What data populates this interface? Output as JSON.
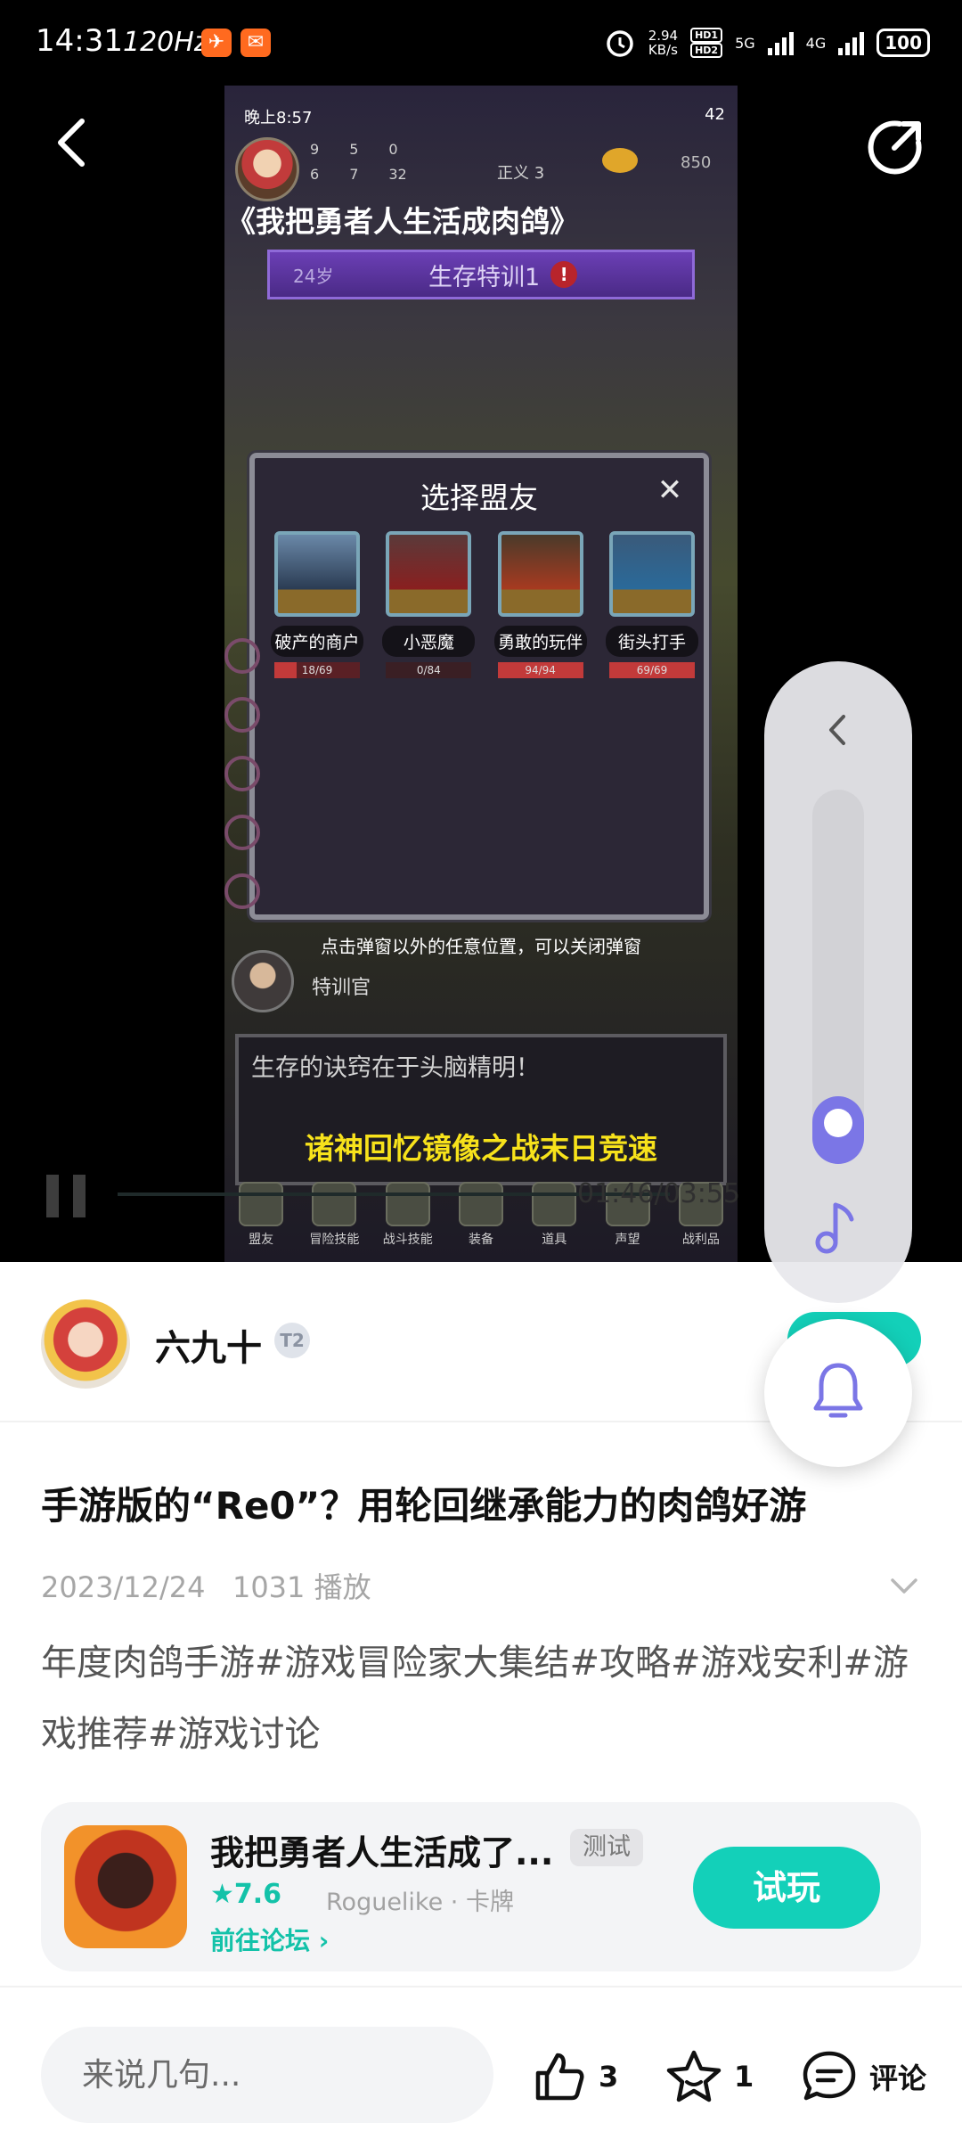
{
  "status_bar": {
    "time": "14:31",
    "refresh": "120Hz",
    "net_speed_value": "2.94",
    "net_speed_unit": "KB/s",
    "hd1": "HD1",
    "hd2": "HD2",
    "net1": "5G",
    "net2": "4G",
    "battery": "100"
  },
  "video": {
    "game_status": {
      "time": "晚上8:57",
      "battery": "42"
    },
    "stats": [
      "9",
      "5",
      "0",
      "6",
      "7",
      "32"
    ],
    "justice": "正义 3",
    "gold": "850",
    "title": "《我把勇者人生活成肉鸽》",
    "age": "24岁",
    "stage": "生存特训1",
    "alert": "!",
    "dialog_title": "选择盟友",
    "close": "✕",
    "allies": [
      {
        "name": "破产的商户",
        "hp": "18/69"
      },
      {
        "name": "小恶魔",
        "hp": "0/84"
      },
      {
        "name": "勇敢的玩伴",
        "hp": "94/94"
      },
      {
        "name": "街头打手",
        "hp": "69/69"
      }
    ],
    "hint": "点击弹窗以外的任意位置，可以关闭弹窗",
    "officer": "特训官",
    "dialog_line": "生存的诀窍在于头脑精明！",
    "subtitle": "诸神回忆镜像之战末日竞速",
    "nav": [
      "盟友",
      "冒险技能",
      "战斗技能",
      "装备",
      "道具",
      "声望",
      "战利品"
    ],
    "elapsed_ghost": "01:46/03:55"
  },
  "volume_panel": {
    "level": 0.12
  },
  "author": {
    "name": "六九十",
    "badge": "T2"
  },
  "post": {
    "title": "手游版的“Re0”？用轮回继承能力的肉鸽好游",
    "date": "2023/12/24",
    "plays": "1031 播放",
    "description": "年度肉鸽手游#游戏冒险家大集结#攻略#游戏安利#游戏推荐#游戏讨论"
  },
  "game_card": {
    "name": "我把勇者人生活成了...",
    "tag": "测试",
    "rating": "★7.6",
    "genre": "Roguelike · 卡牌",
    "forum_link": "前往论坛 ›",
    "play_label": "试玩"
  },
  "bottom_bar": {
    "comment_placeholder": "来说几句...",
    "likes": "3",
    "favorites": "1",
    "comment_label": "评论"
  },
  "colors": {
    "accent": "#13d0b9",
    "slider": "#7b76e6",
    "subtitle_yellow": "#f7e21b"
  }
}
